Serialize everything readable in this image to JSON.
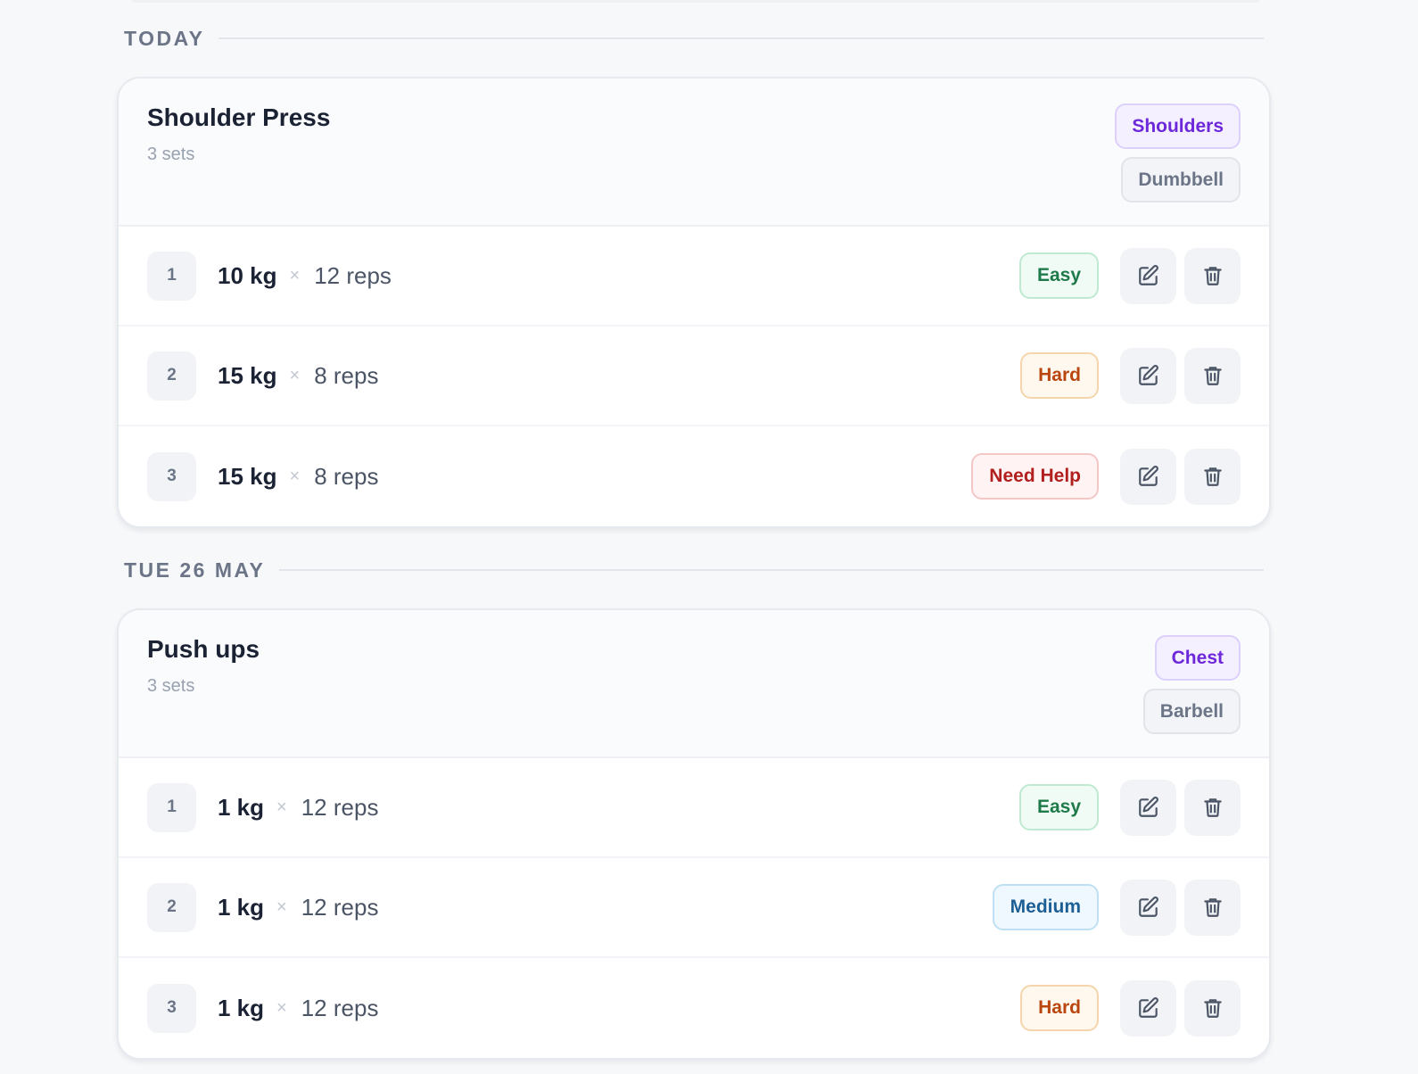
{
  "sessions": [
    {
      "date": "TODAY",
      "exercise": "Shoulder Press",
      "sets_label": "3 sets",
      "muscle": "Shoulders",
      "equipment": "Dumbbell",
      "sets": [
        {
          "num": "1",
          "weight": "10 kg",
          "reps": "12 reps",
          "difficulty": "Easy"
        },
        {
          "num": "2",
          "weight": "15 kg",
          "reps": "8 reps",
          "difficulty": "Hard"
        },
        {
          "num": "3",
          "weight": "15 kg",
          "reps": "8 reps",
          "difficulty": "Need Help"
        }
      ]
    },
    {
      "date": "TUE 26 MAY",
      "exercise": "Push ups",
      "sets_label": "3 sets",
      "muscle": "Chest",
      "equipment": "Barbell",
      "sets": [
        {
          "num": "1",
          "weight": "1 kg",
          "reps": "12 reps",
          "difficulty": "Easy"
        },
        {
          "num": "2",
          "weight": "1 kg",
          "reps": "12 reps",
          "difficulty": "Medium"
        },
        {
          "num": "3",
          "weight": "1 kg",
          "reps": "12 reps",
          "difficulty": "Hard"
        }
      ]
    }
  ],
  "times_symbol": "×",
  "icons": {
    "edit": "edit-icon",
    "delete": "trash-icon"
  },
  "colors": {
    "easy": "#1f7a4a",
    "medium": "#1d5f95",
    "hard": "#b9460f",
    "need_help": "#b1201f",
    "muscle_tag": "#6d28d9"
  }
}
